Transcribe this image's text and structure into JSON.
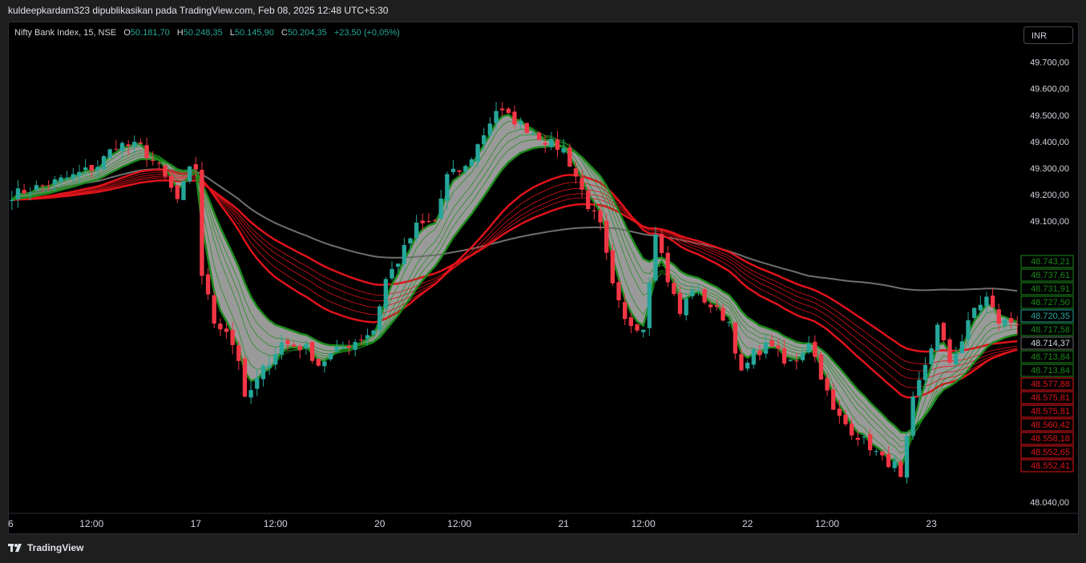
{
  "header": {
    "caption": "kuldeepkardam323 dipublikasikan pada TradingView.com, Feb 08, 2025 12:48 UTC+5:30"
  },
  "legend": {
    "symbol": "Nifty Bank Index, 15, NSE",
    "o_label": "O",
    "o_value": "50.181,70",
    "h_label": "H",
    "h_value": "50.248,35",
    "l_label": "L",
    "l_value": "50.145,90",
    "c_label": "C",
    "c_value": "50.204,35",
    "change": "+23,50 (+0,05%)"
  },
  "currency_button": "INR",
  "footer": {
    "brand": "TradingView"
  },
  "colors": {
    "up": "#26a69a",
    "down": "#f23645",
    "fast_ema": "#1b8a1b",
    "slow_ema": "#e0131b",
    "band": "#9a9a9a",
    "long_ma": "#6f6f6f"
  },
  "chart_data": {
    "type": "candlestick",
    "ylim": [
      48000,
      49850
    ],
    "y_ticks": [
      "49.700,00",
      "49.600,00",
      "49.500,00",
      "49.400,00",
      "49.300,00",
      "49.200,00",
      "49.100,00",
      "48.040,00"
    ],
    "y_tick_values": [
      49700,
      49600,
      49500,
      49400,
      49300,
      49200,
      49100,
      48040
    ],
    "x_ticks": [
      "6",
      "12:00",
      "17",
      "12:00",
      "20",
      "12:00",
      "21",
      "12:00",
      "22",
      "12:00",
      "23"
    ],
    "x_tick_bars": [
      0,
      13,
      30,
      43,
      60,
      73,
      90,
      103,
      120,
      133,
      150
    ],
    "price_tags": [
      {
        "label": "48.743,21",
        "value": 48743.21,
        "color": "#1b8a1b"
      },
      {
        "label": "48.737,61",
        "value": 48737.61,
        "color": "#1b8a1b"
      },
      {
        "label": "48.731,91",
        "value": 48731.91,
        "color": "#1b8a1b"
      },
      {
        "label": "48.727,50",
        "value": 48727.5,
        "color": "#1b8a1b"
      },
      {
        "label": "48.720,35",
        "value": 48720.35,
        "color": "#26a69a"
      },
      {
        "label": "48.717,58",
        "value": 48717.58,
        "color": "#1b8a1b"
      },
      {
        "label": "48.714,37",
        "value": 48714.37,
        "color": "#6f6f6f"
      },
      {
        "label": "48.713,84",
        "value": 48713.84,
        "color": "#1b8a1b"
      },
      {
        "label": "48.713,84",
        "value": 48713.84,
        "color": "#1b8a1b"
      },
      {
        "label": "48.577,88",
        "value": 48577.88,
        "color": "#e0131b"
      },
      {
        "label": "48.575,81",
        "value": 48575.81,
        "color": "#e0131b"
      },
      {
        "label": "48.575,81",
        "value": 48575.81,
        "color": "#e0131b"
      },
      {
        "label": "48.560,42",
        "value": 48560.42,
        "color": "#e0131b"
      },
      {
        "label": "48.558,18",
        "value": 48558.18,
        "color": "#e0131b"
      },
      {
        "label": "48.552,65",
        "value": 48552.65,
        "color": "#e0131b"
      },
      {
        "label": "48.552,41",
        "value": 48552.41,
        "color": "#e0131b"
      }
    ],
    "close_path": [
      [
        0,
        49200
      ],
      [
        3,
        49220
      ],
      [
        6,
        49240
      ],
      [
        10,
        49270
      ],
      [
        14,
        49310
      ],
      [
        17,
        49390
      ],
      [
        21,
        49380
      ],
      [
        24,
        49300
      ],
      [
        27,
        49180
      ],
      [
        29,
        49290
      ],
      [
        30,
        49300
      ],
      [
        31,
        48900
      ],
      [
        33,
        48720
      ],
      [
        35,
        48690
      ],
      [
        37,
        48580
      ],
      [
        38,
        48420
      ],
      [
        41,
        48540
      ],
      [
        44,
        48640
      ],
      [
        48,
        48620
      ],
      [
        50,
        48560
      ],
      [
        53,
        48610
      ],
      [
        57,
        48660
      ],
      [
        59,
        48690
      ],
      [
        61,
        48880
      ],
      [
        63,
        48950
      ],
      [
        66,
        49080
      ],
      [
        69,
        49100
      ],
      [
        71,
        49270
      ],
      [
        74,
        49300
      ],
      [
        77,
        49430
      ],
      [
        79,
        49520
      ],
      [
        82,
        49480
      ],
      [
        84,
        49450
      ],
      [
        86,
        49420
      ],
      [
        88,
        49390
      ],
      [
        90,
        49370
      ],
      [
        92,
        49270
      ],
      [
        94,
        49160
      ],
      [
        96,
        49080
      ],
      [
        98,
        48850
      ],
      [
        100,
        48720
      ],
      [
        103,
        48700
      ],
      [
        105,
        49070
      ],
      [
        107,
        48880
      ],
      [
        109,
        48750
      ],
      [
        111,
        48850
      ],
      [
        114,
        48780
      ],
      [
        117,
        48720
      ],
      [
        119,
        48520
      ],
      [
        121,
        48600
      ],
      [
        124,
        48640
      ],
      [
        126,
        48560
      ],
      [
        128,
        48580
      ],
      [
        130,
        48650
      ],
      [
        132,
        48520
      ],
      [
        134,
        48380
      ],
      [
        137,
        48310
      ],
      [
        140,
        48250
      ],
      [
        142,
        48200
      ],
      [
        144,
        48180
      ],
      [
        145,
        48120
      ],
      [
        147,
        48420
      ],
      [
        149,
        48560
      ],
      [
        151,
        48700
      ],
      [
        153,
        48570
      ],
      [
        155,
        48650
      ],
      [
        157,
        48770
      ],
      [
        159,
        48810
      ],
      [
        161,
        48720
      ],
      [
        163,
        48720
      ]
    ]
  }
}
